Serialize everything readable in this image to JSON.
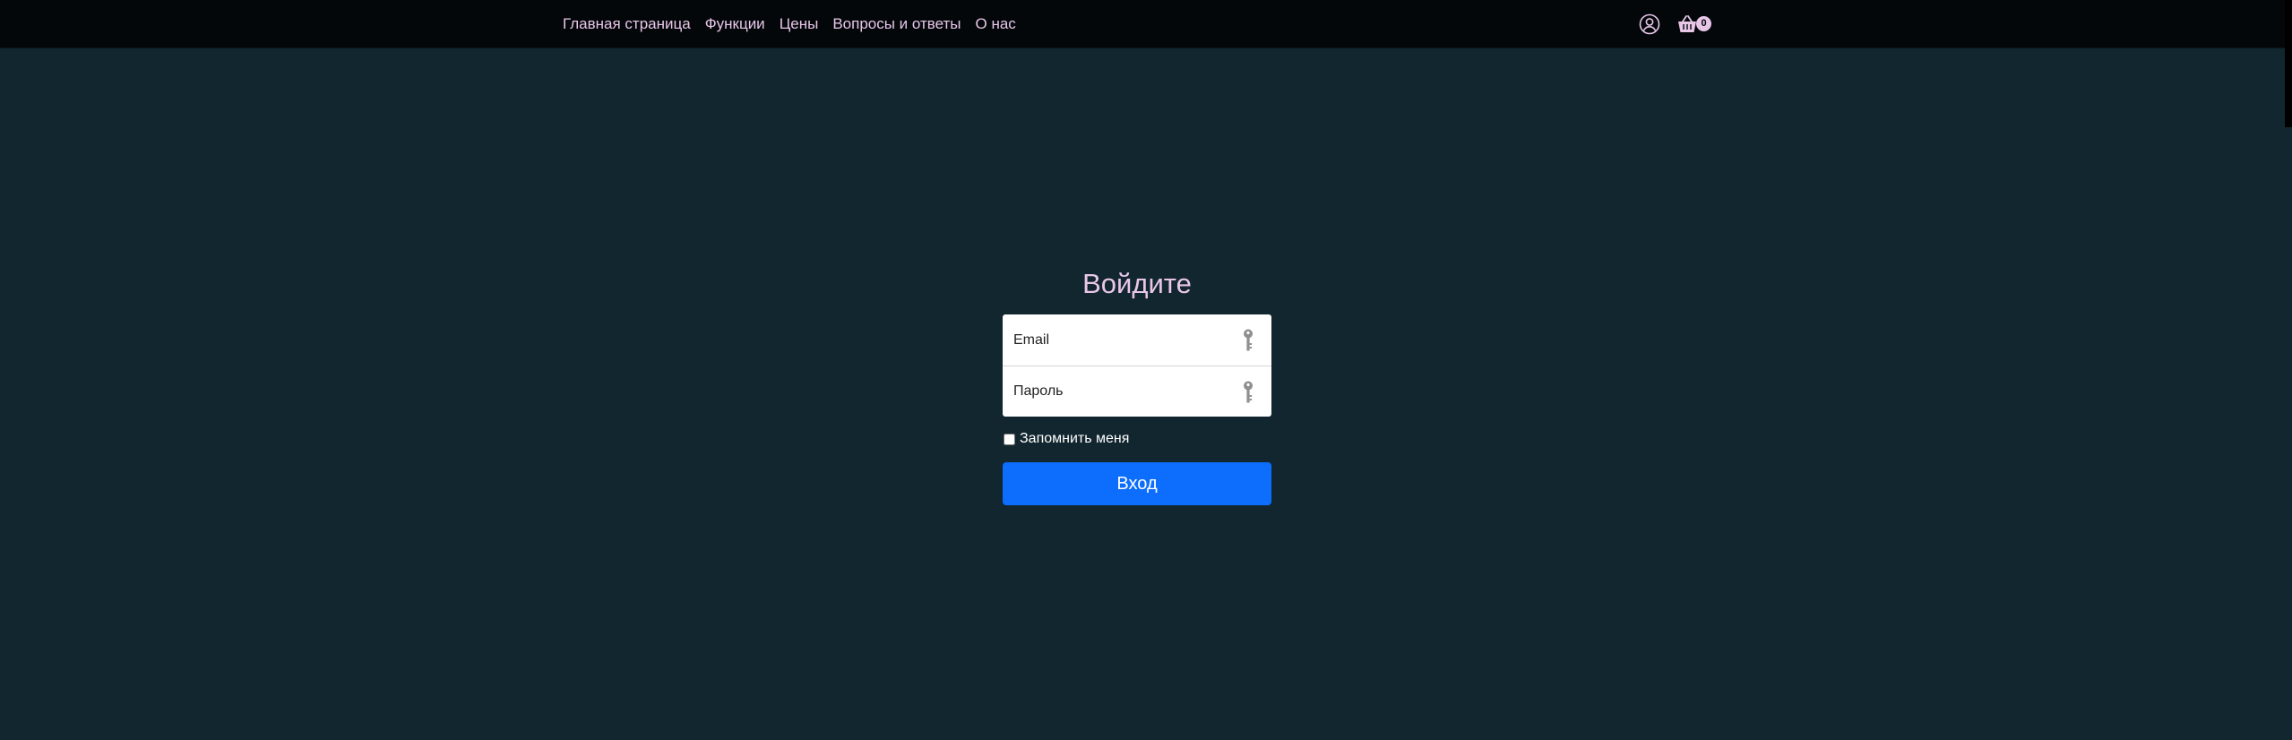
{
  "nav": {
    "links": [
      "Главная страница",
      "Функции",
      "Цены",
      "Вопросы и ответы",
      "О нас"
    ],
    "cart_count": "0",
    "icons": [
      "user-circle-icon",
      "shopping-basket-icon"
    ],
    "accent_color": "#e8c6e8"
  },
  "login": {
    "title": "Войдите",
    "email_placeholder": "Email",
    "password_placeholder": "Пароль",
    "field_icon": "key-icon",
    "remember_label": "Запомнить меня",
    "remember_checked": false,
    "submit_label": "Вход",
    "submit_color": "#0d6efd"
  },
  "colors": {
    "background": "#11262f",
    "navbar": "#03070a"
  }
}
